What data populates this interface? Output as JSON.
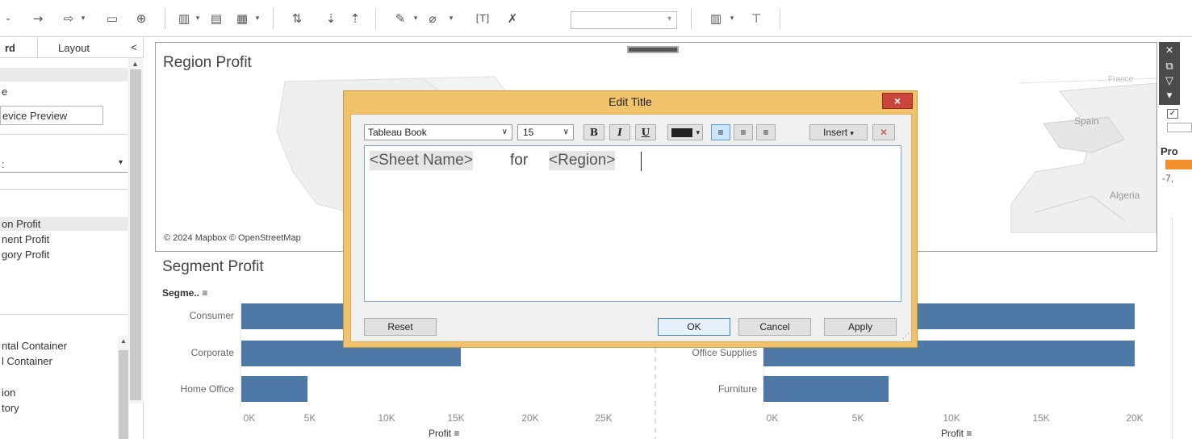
{
  "toolbar": {
    "combo_value": "",
    "icons": [
      "minus-icon",
      "redo-icon",
      "swap-icon",
      "presentation-icon",
      "new-sheet-icon",
      "new-dashboard-icon",
      "duplicate-icon",
      "clear-sheet-icon",
      "swap-rows-icon",
      "sort-asc-icon",
      "sort-desc-icon",
      "highlight-icon",
      "group-icon",
      "label-icon",
      "fix-axes-icon",
      "show-me-icon",
      "present-icon"
    ]
  },
  "left_panel": {
    "tab_dashboard": "rd",
    "tab_layout": "Layout",
    "collapse": "<",
    "size_item": "e",
    "device_preview_label": "evice Preview",
    "size_select": ":",
    "sheets": [
      "on Profit",
      "nent Profit",
      "gory Profit"
    ],
    "objects": [
      "ntal Container",
      "l Container",
      "ion",
      "tory"
    ]
  },
  "map": {
    "title": "Region Profit",
    "labels": [
      "Spain",
      "Algeria",
      "France"
    ],
    "attribution": "© 2024 Mapbox © OpenStreetMap"
  },
  "map_controls": [
    "×",
    "⧉",
    "▽",
    "▾"
  ],
  "legend": {
    "title": "Pro",
    "value": "-7,",
    "swatch_color": "#f28e2b"
  },
  "segment": {
    "title": "Segment Profit",
    "header": "Segme..",
    "sort_icon": "≡",
    "categories": [
      "Consumer",
      "Corporate",
      "Home Office"
    ],
    "ticks": [
      "0K",
      "5K",
      "10K",
      "15K",
      "20K",
      "25K"
    ],
    "axis_title": "Profit",
    "color": "#4e79a7"
  },
  "category": {
    "categories": [
      "",
      "Office Supplies",
      "Furniture"
    ],
    "ticks": [
      "0K",
      "5K",
      "10K",
      "15K",
      "20K"
    ],
    "axis_title": "Profit"
  },
  "dialog": {
    "title": "Edit Title",
    "close": "×",
    "font": "Tableau Book",
    "size": "15",
    "bold": "B",
    "italic": "I",
    "underline": "U",
    "insert": "Insert",
    "clear": "✕",
    "token_sheet": "<Sheet Name>",
    "text_for": "for",
    "token_region": "<Region>",
    "reset": "Reset",
    "ok": "OK",
    "cancel": "Cancel",
    "apply": "Apply"
  }
}
